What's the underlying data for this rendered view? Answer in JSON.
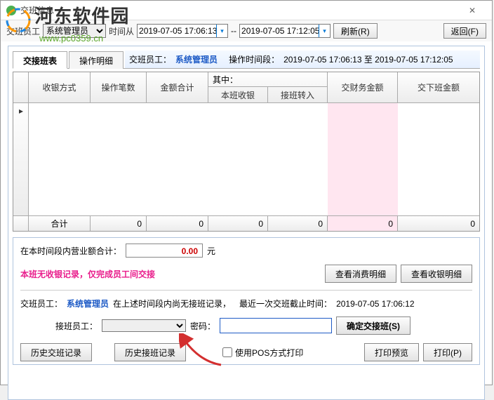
{
  "window": {
    "title": "交班信息"
  },
  "watermark": {
    "name": "河东软件园",
    "url": "www.pc0359.cn"
  },
  "toolbar": {
    "staff_label": "交班员工",
    "staff_value": "系统管理员",
    "time_label": "时间从",
    "time_from": "2019-07-05 17:06:13",
    "time_sep": "--",
    "time_to": "2019-07-05 17:12:05",
    "refresh": "刷新(R)",
    "back": "返回(F)"
  },
  "tabs": {
    "tab1": "交接班表",
    "tab2": "操作明细"
  },
  "info": {
    "staff_label": "交班员工：",
    "staff_value": "系统管理员",
    "period_label": "操作时间段：",
    "period_value": "2019-07-05 17:06:13 至 2019-07-05 17:12:05"
  },
  "grid": {
    "headers": {
      "c1": "收银方式",
      "c2": "操作笔数",
      "c3": "金额合计",
      "group": "其中：",
      "c4a": "本班收银",
      "c4b": "接班转入",
      "c5": "交财务金额",
      "c6": "交下班金额"
    },
    "footer": {
      "label": "合计",
      "v1": "0",
      "v2": "0",
      "v3": "0",
      "v4": "0",
      "v5": "0",
      "v6": "0"
    }
  },
  "bottom": {
    "sales_label": "在本时间段内营业额合计：",
    "sales_value": "0.00",
    "sales_unit": "元",
    "warning": "本班无收银记录，仅完成员工间交接",
    "btn_detail1": "查看消费明细",
    "btn_detail2": "查看收银明细",
    "line2_staff_label": "交班员工：",
    "line2_staff_value": "系统管理员",
    "line2_text": "在上述时间段内尚无接班记录，",
    "line2_last_label": "最近一次交班截止时间：",
    "line2_last_value": "2019-07-05 17:06:12",
    "recv_label": "接班员工：",
    "pwd_label": "密码：",
    "confirm_btn": "确定交接班(S)",
    "hist1": "历史交班记录",
    "hist2": "历史接班记录",
    "pos_check": "使用POS方式打印",
    "preview": "打印预览",
    "print": "打印(P)"
  }
}
